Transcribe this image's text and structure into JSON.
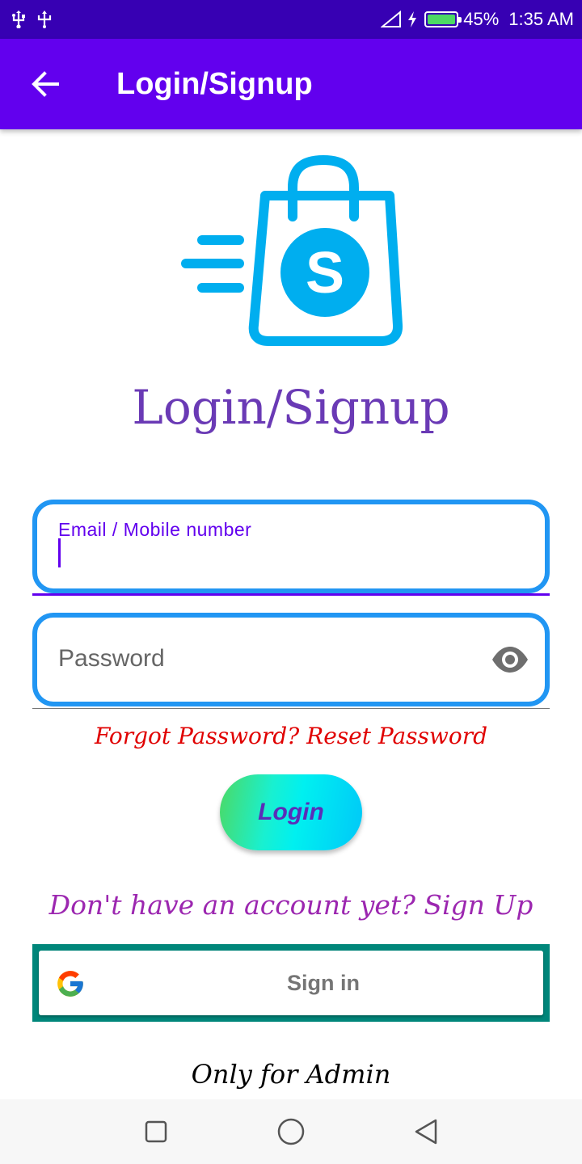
{
  "status_bar": {
    "left_icons": [
      "usb-icon",
      "usb-icon"
    ],
    "battery_percent": "45%",
    "battery_level": 0.45,
    "time": "1:35 AM"
  },
  "app_bar": {
    "title": "Login/Signup",
    "back_icon": "arrow-left-icon",
    "color": "#6200EE"
  },
  "logo": {
    "icon": "shopping-bag-s-icon",
    "letter": "S",
    "color": "#00AEEF"
  },
  "heading": "Login/Signup",
  "email_field": {
    "label": "Email / Mobile number",
    "value": ""
  },
  "password_field": {
    "placeholder": "Password",
    "toggle_icon": "eye-icon"
  },
  "forgot_link": "Forgot Password? Reset Password",
  "login_button": "Login",
  "signup_link": "Don't have an account yet? Sign Up",
  "google_signin": {
    "label": "Sign in",
    "icon": "google-icon"
  },
  "admin_link": "Only for Admin",
  "nav_bar": {
    "buttons": [
      "square-recents-icon",
      "circle-home-icon",
      "triangle-back-icon"
    ]
  }
}
